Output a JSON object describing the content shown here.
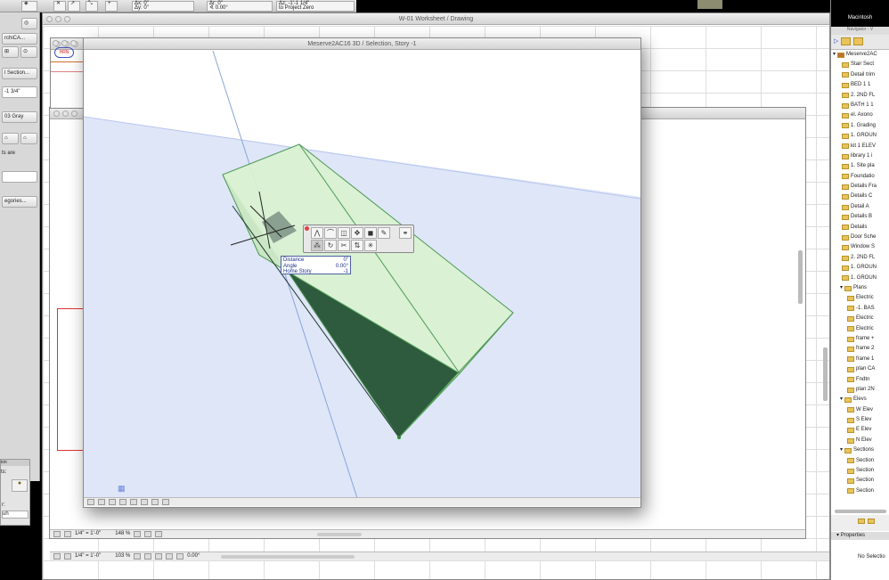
{
  "toolbar": {
    "dx": "Δx: 0\"",
    "dy": "Δy: 0\"",
    "dr": "Δr: 0\"",
    "angle": "∢ 0.00°",
    "dz": "Δz: -1'-1 1/4\"",
    "to_project_zero": "to Project Zero"
  },
  "top_right": {
    "disk_label": "Macintosh"
  },
  "left_panel": {
    "items": [
      "rchiCA...",
      "l Section...",
      "-1 3/4\"",
      "03 Gray",
      "ts are",
      "egories..."
    ],
    "lower": {
      "title": "ion",
      "label1": "ts:",
      "label2": "r:",
      "select": "uh"
    }
  },
  "worksheet_window": {
    "title": "W-01 Worksheet / Drawing",
    "scale": "1/4\"  =  1'-0\"",
    "zoom": "103 %",
    "angle": "0.00°"
  },
  "back_window": {
    "scale": "1/4\"  =  1'-0\"",
    "zoom": "148 %"
  },
  "window_3d": {
    "title": "Meserve2AC16 3D / Selection, Story -1",
    "logo": "HRN"
  },
  "tracker": {
    "rows": [
      {
        "label": "Distance",
        "value": "0\""
      },
      {
        "label": "Angle",
        "value": "0.00°"
      },
      {
        "label": "Home Story",
        "value": "-1"
      }
    ]
  },
  "navigator": {
    "title": "Navigator - V",
    "root": "Meserve2AC",
    "items": [
      "Stair Sect",
      "Detail trim",
      "BED 1 1",
      "2. 2ND FL",
      "BATH 1 1",
      "el. Axono",
      "1. Grading",
      "1. GROUN",
      "kit 1 ELEV",
      "library 1 i",
      "1. Site pla",
      "Foundatio",
      "Details Fra",
      "Details C",
      "Detail A",
      "Details B",
      "Details",
      "Door Sche",
      "Window S",
      "2. 2ND FL",
      "1. GROUN",
      "1. GROUN"
    ],
    "plans": {
      "label": "Plans",
      "items": [
        "Electric",
        "-1. BAS",
        "Electric",
        "Electric",
        "frame +",
        "frame 2",
        "frame 1",
        "plan CA",
        "Fndtn",
        "plan 2N"
      ]
    },
    "elevs": {
      "label": "Elevs",
      "items": [
        "W Elev",
        "S Elev",
        "E Elev",
        "N Elev"
      ]
    },
    "sections": {
      "label": "Sections",
      "items": [
        "Section",
        "Section",
        "Section",
        "Section"
      ]
    },
    "properties_label": "Properties",
    "no_selection": "No Selectio"
  },
  "colors": {
    "viewport_bg": "#dfe6f8",
    "plane": "#eef2fd",
    "top_face": "#d9f2d0",
    "dark_face": "#2e5a3e",
    "edge": "#4f9a55"
  }
}
